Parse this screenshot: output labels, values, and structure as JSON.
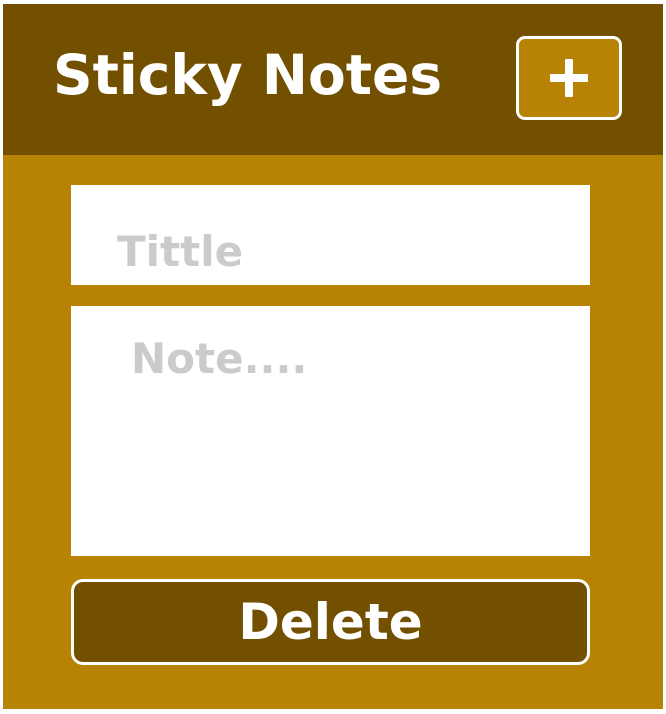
{
  "app": {
    "title": "Sticky Notes",
    "add_button": {
      "icon": "plus-icon",
      "label": "+"
    }
  },
  "note": {
    "title_value": "",
    "title_placeholder": "Tittle",
    "body_value": "",
    "body_placeholder": "Note....",
    "delete_label": "Delete"
  },
  "colors": {
    "header": "#725000",
    "panel": "#b88304",
    "delete_button": "#725000",
    "add_button": "#b88304",
    "placeholder": "#cbcbcb"
  }
}
